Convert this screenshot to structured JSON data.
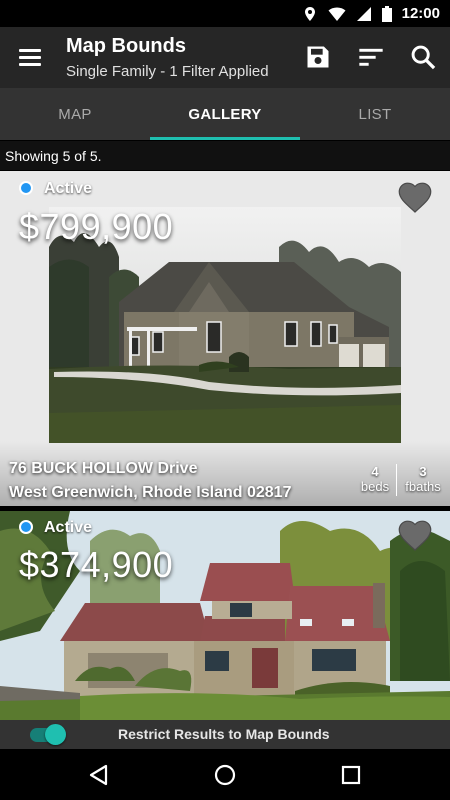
{
  "status_bar": {
    "time": "12:00",
    "icons": [
      "location-icon",
      "wifi-icon",
      "signal-icon",
      "battery-icon"
    ]
  },
  "app_bar": {
    "title": "Map Bounds",
    "subtitle": "Single Family - 1 Filter Applied",
    "actions": [
      "save-icon",
      "sort-icon",
      "search-icon"
    ]
  },
  "tabs": [
    {
      "label": "MAP",
      "active": false
    },
    {
      "label": "GALLERY",
      "active": true
    },
    {
      "label": "LIST",
      "active": false
    }
  ],
  "results": {
    "text": "Showing 5 of 5."
  },
  "listings": [
    {
      "status": "Active",
      "price": "$799,900",
      "address_line1": "76 BUCK HOLLOW Drive",
      "address_line2": "West Greenwich, Rhode Island 02817",
      "beds_value": "4",
      "beds_label": "beds",
      "baths_value": "3",
      "baths_label": "fbaths"
    },
    {
      "status": "Active",
      "price": "$374,900"
    }
  ],
  "restrict": {
    "label": "Restrict Results to Map Bounds",
    "enabled": true
  },
  "colors": {
    "accent": "#1fbfb0",
    "status_active": "#2196f3",
    "app_bar": "#262626",
    "tab_bar": "#333333"
  },
  "nav": [
    "back-icon",
    "home-icon",
    "recents-icon"
  ]
}
